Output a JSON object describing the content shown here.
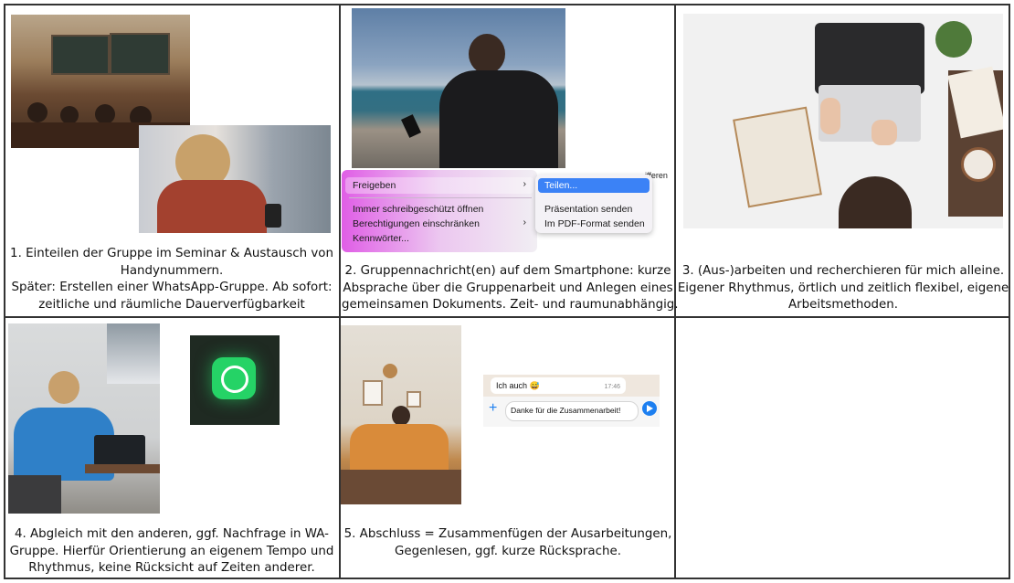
{
  "captions": {
    "c1": [
      "1. Einteilen der Gruppe im Seminar & Austausch von",
      "Handynummern.",
      "Später: Erstellen einer WhatsApp-Gruppe. Ab sofort:",
      "zeitliche und räumliche Dauerverfügbarkeit"
    ],
    "c2": [
      "2. Gruppennachricht(en) auf dem Smartphone: kurze",
      "Absprache über die Gruppenarbeit und Anlegen eines",
      "gemeinsamen Dokuments. Zeit- und raumunabhängig."
    ],
    "c3": [
      "3. (Aus-)arbeiten und recherchieren für mich alleine.",
      "Eigener Rhythmus, örtlich und zeitlich flexibel, eigene",
      "Arbeitsmethoden."
    ],
    "c4": [
      "4. Abgleich mit den anderen, ggf. Nachfrage in WA-",
      "Gruppe. Hierfür Orientierung an eigenem Tempo und",
      "Rhythmus, keine Rücksicht auf Zeiten anderer."
    ],
    "c5": [
      "5. Abschluss = Zusammenfügen der Ausarbeitungen,",
      "Gegenlesen, ggf. kurze Rücksprache."
    ]
  },
  "menu": {
    "freigeben": "Freigeben",
    "immer": "Immer schreibgeschützt öffnen",
    "berechtigungen": "Berechtigungen einschränken",
    "kennwoerter": "Kennwörter...",
    "cut_text": "ifferen",
    "chevron": "›"
  },
  "submenu": {
    "teilen": "Teilen...",
    "praesentation": "Präsentation senden",
    "pdf": "Im PDF-Format senden"
  },
  "chat": {
    "incoming": "Ich auch 😅",
    "time": "17:46",
    "input": "Danke für die Zusammenarbeit!",
    "plus": "+"
  },
  "colors": {
    "border": "#333333",
    "menu_highlight": "#d946ef",
    "selection": "#3b82f6",
    "whatsapp": "#25d366",
    "send_button": "#1d7ff0"
  }
}
